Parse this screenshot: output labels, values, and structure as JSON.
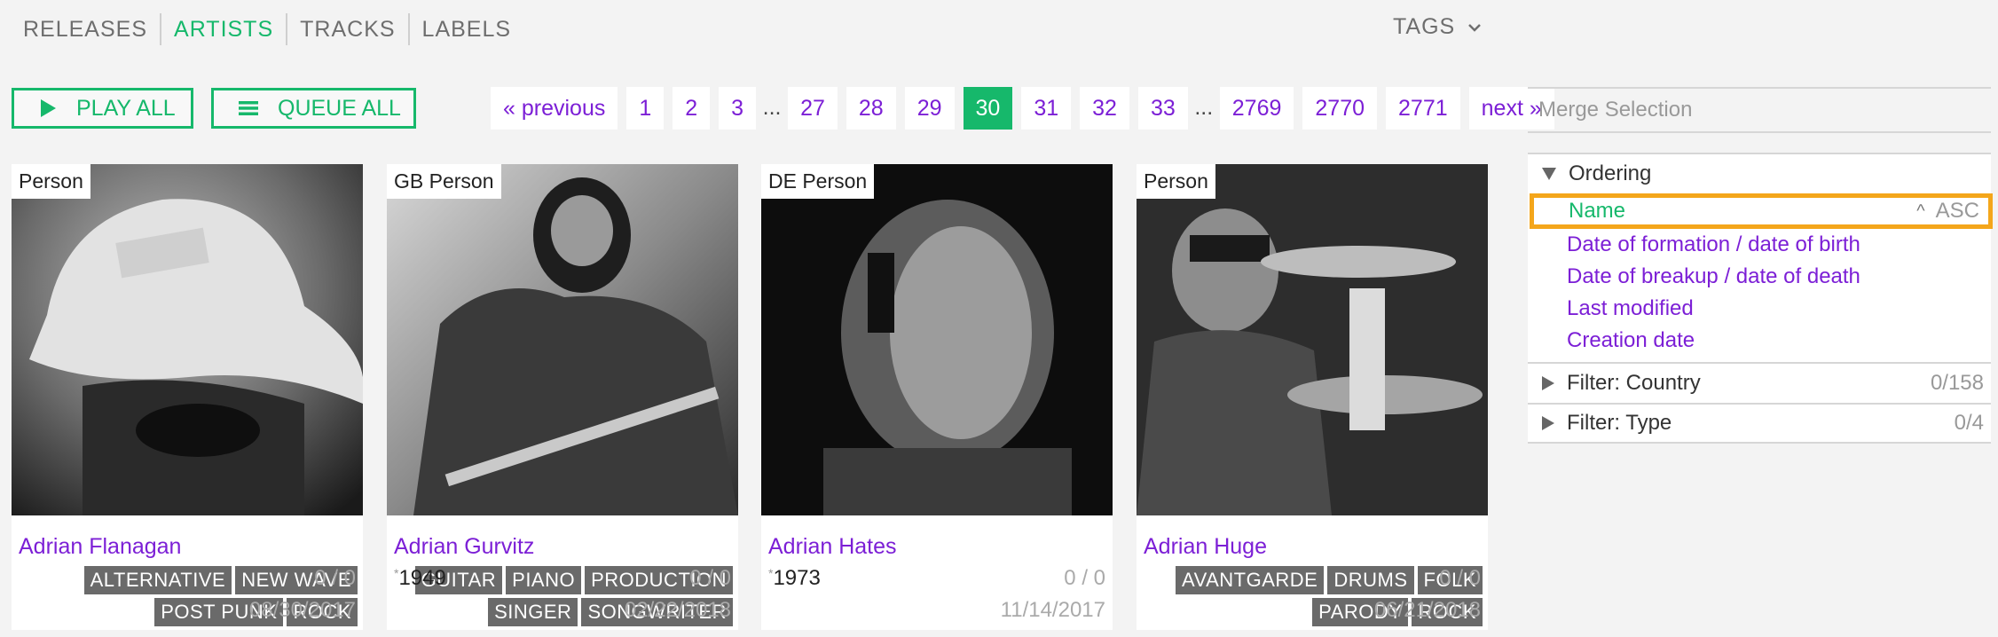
{
  "nav": {
    "items": [
      "RELEASES",
      "ARTISTS",
      "TRACKS",
      "LABELS"
    ],
    "active": "ARTISTS",
    "tags_label": "TAGS"
  },
  "actions": {
    "play_all": "PLAY ALL",
    "queue_all": "QUEUE ALL"
  },
  "pagination": {
    "previous": "« previous",
    "next": "next »",
    "pages_before": [
      "1",
      "2",
      "3"
    ],
    "pages_middle": [
      "27",
      "28",
      "29",
      "30",
      "31",
      "32",
      "33"
    ],
    "pages_after": [
      "2769",
      "2770",
      "2771"
    ],
    "current": "30",
    "ellipsis": "..."
  },
  "artists": [
    {
      "type": "Person",
      "name": "Adrian Flanagan",
      "year": "",
      "count": "0 / 0",
      "date": "08/30/2017",
      "tags": [
        [
          "ALTERNATIVE",
          "NEW WAVE"
        ],
        [
          "POST PUNK",
          "ROCK"
        ]
      ]
    },
    {
      "type": "GB Person",
      "name": "Adrian Gurvitz",
      "year": "1949",
      "count": "0 / 0",
      "date": "02/22/2018",
      "tags": [
        [
          "GUITAR",
          "PIANO",
          "PRODUCTION"
        ],
        [
          "SINGER",
          "SONGWRITER"
        ]
      ]
    },
    {
      "type": "DE Person",
      "name": "Adrian Hates",
      "year": "1973",
      "count": "0 / 0",
      "date": "11/14/2017",
      "tags": []
    },
    {
      "type": "Person",
      "name": "Adrian Huge",
      "year": "",
      "count": "0 / 0",
      "date": "06/21/2018",
      "tags": [
        [
          "AVANTGARDE",
          "DRUMS",
          "FOLK"
        ],
        [
          "PARODY",
          "ROCK"
        ]
      ]
    }
  ],
  "sidebar": {
    "merge_placeholder": "Merge Selection",
    "ordering": {
      "title": "Ordering",
      "items": [
        "Name",
        "Date of formation / date of birth",
        "Date of breakup / date of death",
        "Last modified",
        "Creation date"
      ],
      "selected": "Name",
      "direction": "ASC",
      "direction_caret": "^"
    },
    "filters": [
      {
        "label": "Filter: Country",
        "count": "0/158"
      },
      {
        "label": "Filter: Type",
        "count": "0/4"
      }
    ]
  },
  "colors": {
    "accent": "#16b86b",
    "link": "#7c1fd6",
    "highlight": "#f4a61b"
  }
}
